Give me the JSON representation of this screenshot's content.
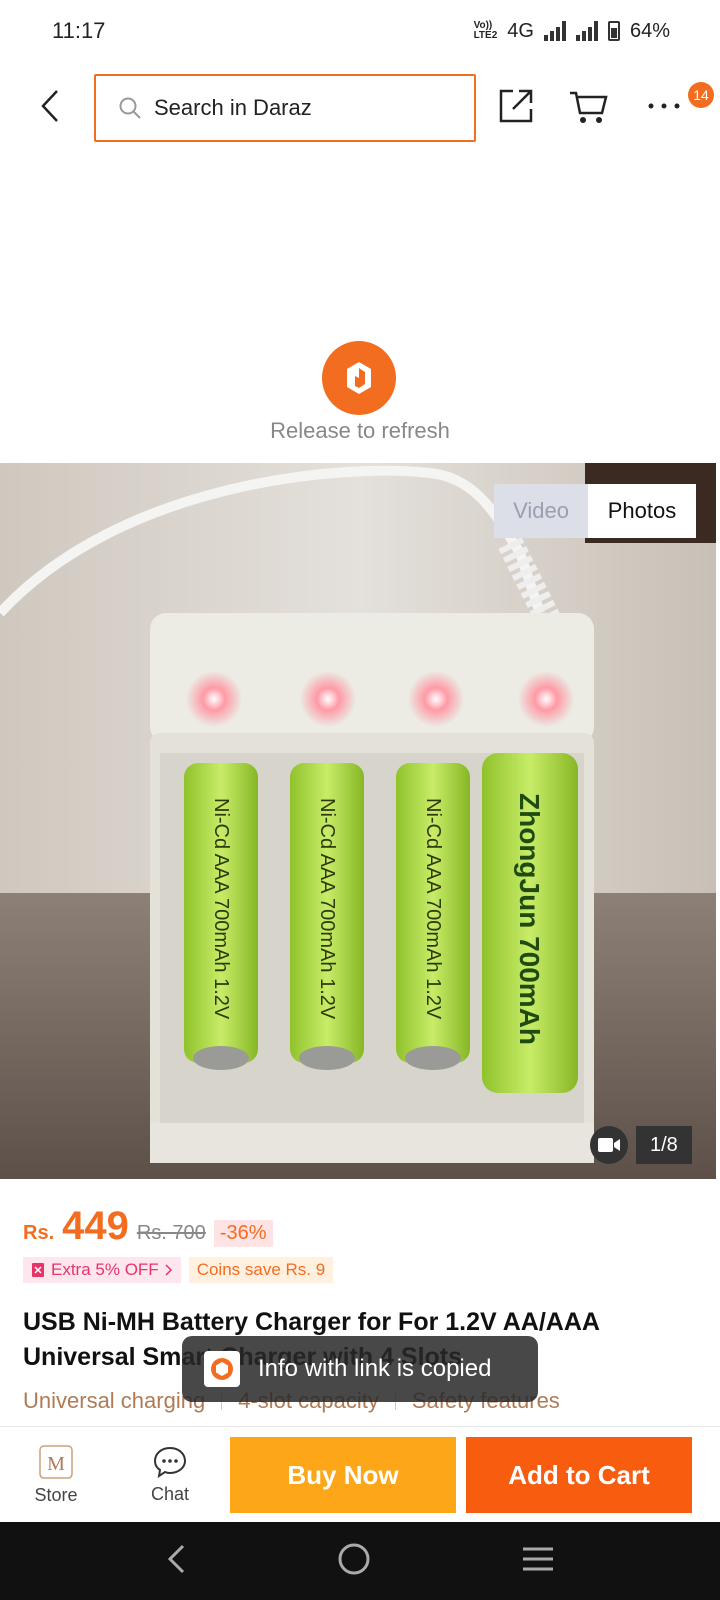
{
  "status_bar": {
    "time": "11:17",
    "volte_line1": "Vo))",
    "volte_line2": "LTE2",
    "network": "4G",
    "battery": "64%"
  },
  "top_nav": {
    "search_placeholder": "Search in Daraz",
    "cart_badge": "14"
  },
  "refresh": {
    "text": "Release to refresh"
  },
  "media": {
    "tab_video": "Video",
    "tab_photos": "Photos",
    "active_tab": "Photos",
    "counter": "1/8",
    "battery_label_1": "Ni-Cd AAA 700mAh 1.2V",
    "battery_label_2": "Ni-Cd AAA 700mAh 1.2V",
    "battery_label_3": "Ni-Cd AAA 700mAh 1.2V",
    "battery_label_4": "ZhongJun 700mAh"
  },
  "product": {
    "currency": "Rs.",
    "price": "449",
    "original_price": "Rs. 700",
    "discount": "-36%",
    "promo_extra": "Extra 5% OFF",
    "promo_coins": "Coins save Rs. 9",
    "title": "USB Ni-MH Battery Charger for For 1.2V AA/AAA Universal Smart Charger with 4 Slots",
    "features": [
      "Universal charging",
      "4-slot capacity",
      "Safety features"
    ]
  },
  "toast": {
    "text": "Info with link is copied"
  },
  "bottom_bar": {
    "store_label": "Store",
    "chat_label": "Chat",
    "buy_now": "Buy Now",
    "add_to_cart": "Add to Cart"
  },
  "colors": {
    "brand_orange": "#f36d21",
    "buy_now_bg": "#fca618",
    "add_to_cart_bg": "#f85c0f"
  }
}
